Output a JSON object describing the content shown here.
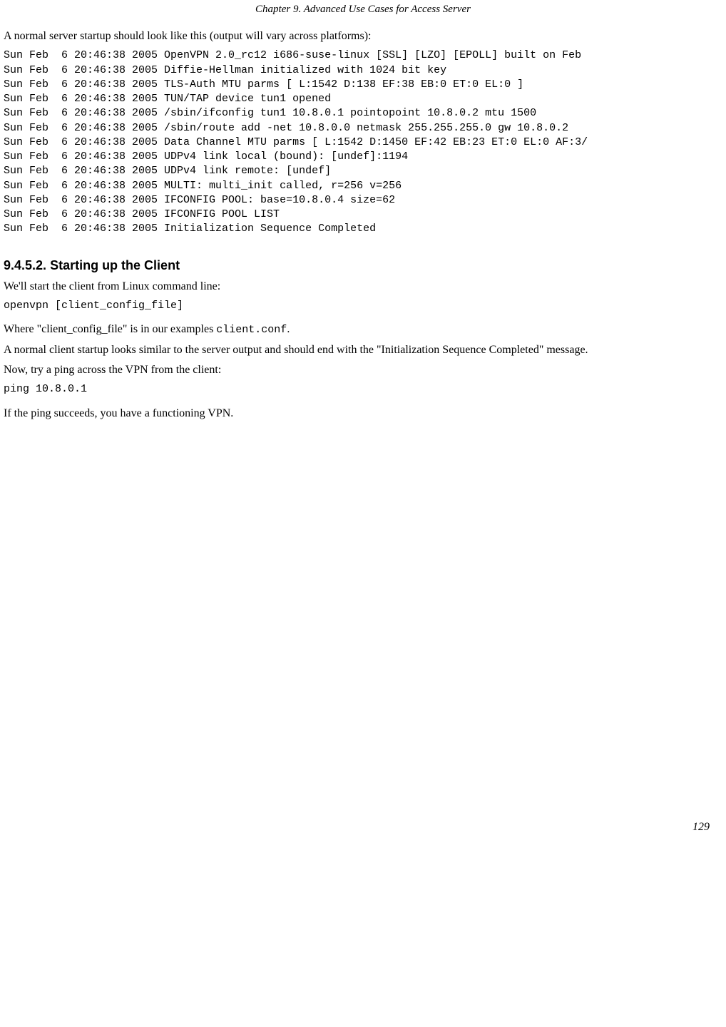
{
  "header": {
    "title": "Chapter 9. Advanced Use Cases for Access Server"
  },
  "intro_para": "A normal server startup should look like this (output will vary across platforms):",
  "server_log": "Sun Feb  6 20:46:38 2005 OpenVPN 2.0_rc12 i686-suse-linux [SSL] [LZO] [EPOLL] built on Feb\nSun Feb  6 20:46:38 2005 Diffie-Hellman initialized with 1024 bit key\nSun Feb  6 20:46:38 2005 TLS-Auth MTU parms [ L:1542 D:138 EF:38 EB:0 ET:0 EL:0 ]\nSun Feb  6 20:46:38 2005 TUN/TAP device tun1 opened\nSun Feb  6 20:46:38 2005 /sbin/ifconfig tun1 10.8.0.1 pointopoint 10.8.0.2 mtu 1500\nSun Feb  6 20:46:38 2005 /sbin/route add -net 10.8.0.0 netmask 255.255.255.0 gw 10.8.0.2\nSun Feb  6 20:46:38 2005 Data Channel MTU parms [ L:1542 D:1450 EF:42 EB:23 ET:0 EL:0 AF:3/\nSun Feb  6 20:46:38 2005 UDPv4 link local (bound): [undef]:1194\nSun Feb  6 20:46:38 2005 UDPv4 link remote: [undef]\nSun Feb  6 20:46:38 2005 MULTI: multi_init called, r=256 v=256\nSun Feb  6 20:46:38 2005 IFCONFIG POOL: base=10.8.0.4 size=62\nSun Feb  6 20:46:38 2005 IFCONFIG POOL LIST\nSun Feb  6 20:46:38 2005 Initialization Sequence Completed",
  "section": {
    "number": "9.4.5.2.",
    "title": "Starting up the Client"
  },
  "client_para1": "We'll start the client from Linux command line:",
  "client_cmd": "openvpn [client_config_file]",
  "client_para2a": "Where \"client_config_file\" is in our examples ",
  "client_para2b": "client.conf",
  "client_para2c": ".",
  "client_para3": "A normal client startup looks similar to the server output and should end with the \"Initialization Sequence Completed\" message.",
  "client_para4": "Now, try a ping across the VPN from the client:",
  "ping_cmd": "ping 10.8.0.1",
  "client_para5": "If the ping succeeds, you have a functioning VPN.",
  "page_number": "129"
}
